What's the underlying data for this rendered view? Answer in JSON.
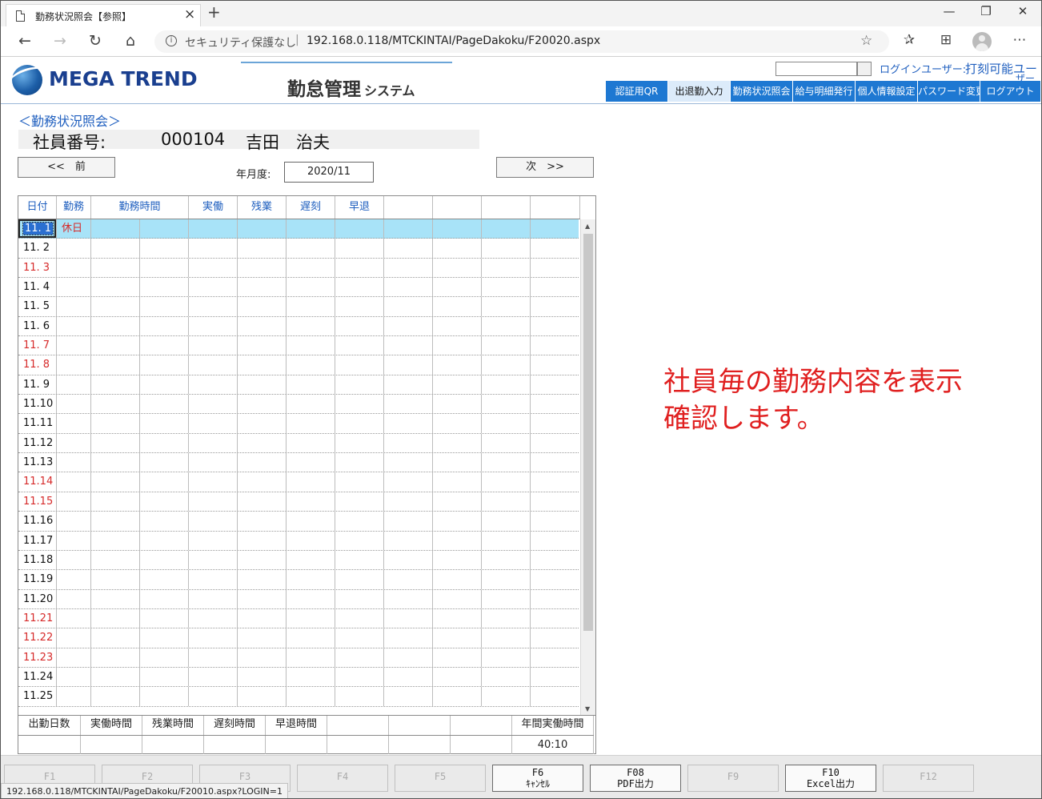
{
  "browser": {
    "tab_title": "勤務状況照会【参照】",
    "security_text": "セキュリティ保護なし",
    "url": "192.168.0.118/MTCKINTAI/PageDakoku/F20020.aspx",
    "status_url": "192.168.0.118/MTCKINTAI/PageDakoku/F20010.aspx?LOGIN=1"
  },
  "header": {
    "logo_text": "MEGA TREND",
    "system_title": "勤怠管理",
    "system_sub": "システム",
    "login_label": "ログインユーザー:",
    "login_user": "打刻可能ユー",
    "login_user_cont": "ザー"
  },
  "menu": [
    {
      "label": "認証用QR",
      "active": false
    },
    {
      "label": "出退勤入力",
      "active": true
    },
    {
      "label": "勤務状況照会",
      "active": false
    },
    {
      "label": "給与明細発行",
      "active": false
    },
    {
      "label": "個人情報設定",
      "active": false
    },
    {
      "label": "パスワード変更",
      "active": false
    },
    {
      "label": "ログアウト",
      "active": false
    }
  ],
  "page": {
    "section_title": "＜勤務状況照会＞",
    "employee_label": "社員番号:",
    "employee_no": "000104",
    "employee_name": "吉田　治夫",
    "prev_label": "<<　前",
    "next_label": "次　>>",
    "ym_label": "年月度:",
    "ym_value": "2020/11"
  },
  "grid": {
    "headers": [
      "日付",
      "勤務",
      "勤務時間",
      "実働",
      "残業",
      "遅刻",
      "早退",
      "",
      "",
      "",
      ""
    ],
    "rows": [
      {
        "date": "11. 1",
        "work": "休日",
        "red": true
      },
      {
        "date": "11. 2",
        "work": "",
        "red": false
      },
      {
        "date": "11. 3",
        "work": "",
        "red": true
      },
      {
        "date": "11. 4",
        "work": "",
        "red": false
      },
      {
        "date": "11. 5",
        "work": "",
        "red": false
      },
      {
        "date": "11. 6",
        "work": "",
        "red": false
      },
      {
        "date": "11. 7",
        "work": "",
        "red": true
      },
      {
        "date": "11. 8",
        "work": "",
        "red": true
      },
      {
        "date": "11. 9",
        "work": "",
        "red": false
      },
      {
        "date": "11.10",
        "work": "",
        "red": false
      },
      {
        "date": "11.11",
        "work": "",
        "red": false
      },
      {
        "date": "11.12",
        "work": "",
        "red": false
      },
      {
        "date": "11.13",
        "work": "",
        "red": false
      },
      {
        "date": "11.14",
        "work": "",
        "red": true
      },
      {
        "date": "11.15",
        "work": "",
        "red": true
      },
      {
        "date": "11.16",
        "work": "",
        "red": false
      },
      {
        "date": "11.17",
        "work": "",
        "red": false
      },
      {
        "date": "11.18",
        "work": "",
        "red": false
      },
      {
        "date": "11.19",
        "work": "",
        "red": false
      },
      {
        "date": "11.20",
        "work": "",
        "red": false
      },
      {
        "date": "11.21",
        "work": "",
        "red": true
      },
      {
        "date": "11.22",
        "work": "",
        "red": true
      },
      {
        "date": "11.23",
        "work": "",
        "red": true
      },
      {
        "date": "11.24",
        "work": "",
        "red": false
      },
      {
        "date": "11.25",
        "work": "",
        "red": false
      }
    ]
  },
  "summary": {
    "headers": [
      "出勤日数",
      "実働時間",
      "残業時間",
      "遅刻時間",
      "早退時間",
      "",
      "",
      "",
      "年間実働時間"
    ],
    "values": [
      "",
      "",
      "",
      "",
      "",
      "",
      "",
      "",
      "40:10"
    ]
  },
  "annotation": {
    "line1": "社員毎の勤務内容を表示",
    "line2": "確認します。"
  },
  "fkeys": [
    {
      "label": "F1",
      "enabled": false
    },
    {
      "label": "F2",
      "enabled": false
    },
    {
      "label": "F3",
      "enabled": false
    },
    {
      "label": "F4",
      "enabled": false
    },
    {
      "label": "F5",
      "enabled": false
    },
    {
      "label": "F6\nｷｬﾝｾﾙ",
      "enabled": true
    },
    {
      "label": "F08\nPDF出力",
      "enabled": true
    },
    {
      "label": "F9",
      "enabled": false
    },
    {
      "label": "F10\nExcel出力",
      "enabled": true
    },
    {
      "label": "F12",
      "enabled": false
    }
  ],
  "colors": {
    "menu_bg": "#1e78d2",
    "menu_active_bg": "#dcebfa",
    "link_blue": "#1f5fbf",
    "holiday_red": "#d62a2a",
    "selected_row": "#a8e3f8",
    "note_red": "#e02020"
  }
}
